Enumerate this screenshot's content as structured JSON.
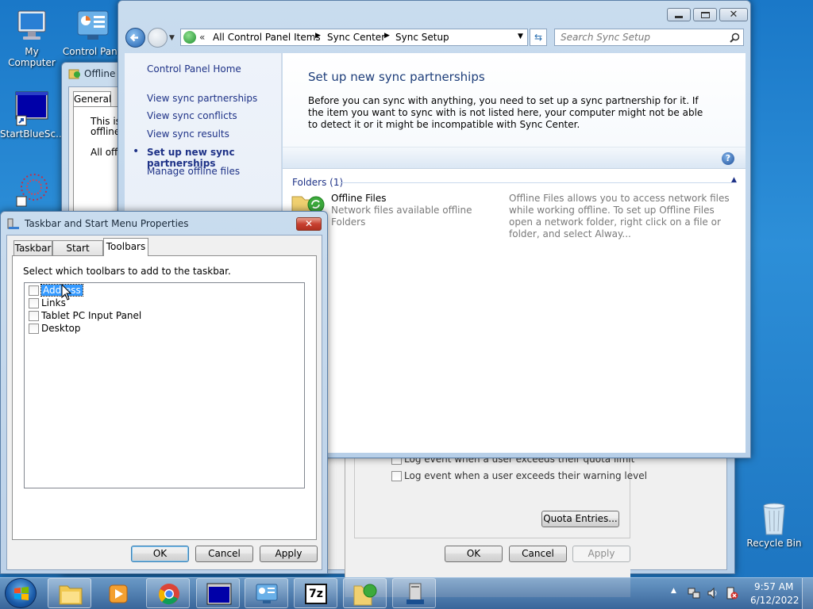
{
  "desktop": {
    "icons": [
      {
        "label": "My Computer"
      },
      {
        "label": "Control Pane"
      },
      {
        "label": "StartBlueSc..."
      },
      {
        "label": "Recycle Bin"
      }
    ]
  },
  "back_dialog": {
    "title": "Offline F",
    "tab_general": "General",
    "text1": "This is",
    "text2": "offline",
    "text3": "All offli",
    "check1": "Log event when a user exceeds their quota limit",
    "check2": "Log event when a user exceeds their warning level",
    "quota_button": "Quota Entries...",
    "ok": "OK",
    "cancel": "Cancel",
    "apply": "Apply"
  },
  "sync_window": {
    "breadcrumb": {
      "sep0": "«",
      "part1": "All Control Panel Items",
      "part2": "Sync Center",
      "part3": "Sync Setup"
    },
    "search_placeholder": "Search Sync Setup",
    "nav": {
      "home": "Control Panel Home",
      "items": [
        "View sync partnerships",
        "View sync conflicts",
        "View sync results",
        "Set up new sync partnerships",
        "Manage offline files"
      ]
    },
    "main": {
      "heading": "Set up new sync partnerships",
      "description": "Before you can sync with anything, you need to set up a sync partnership for it. If the item you want to sync with is not listed here, your computer might not be able to detect it or it might be incompatible with Sync Center.",
      "group_label": "Folders (1)",
      "item_title": "Offline Files",
      "item_sub1": "Network files available offline",
      "item_sub2": "Folders",
      "item_desc": "Offline Files allows you to access network files while working offline. To set up Offline Files open a network folder, right click on a file or folder, and select Alway..."
    }
  },
  "taskbar_dialog": {
    "title": "Taskbar and Start Menu Properties",
    "tabs": [
      "Taskbar",
      "Start Menu",
      "Toolbars"
    ],
    "instruction": "Select which toolbars to add to the taskbar.",
    "toolbars": [
      "Address",
      "Links",
      "Tablet PC Input Panel",
      "Desktop"
    ],
    "ok": "OK",
    "cancel": "Cancel",
    "apply": "Apply"
  },
  "taskbar": {
    "time": "9:57 AM",
    "date": "6/12/2022"
  },
  "colors": {
    "link_blue": "#1e3287",
    "heading_blue": "#1e3e7a",
    "selection": "#3399ff"
  }
}
